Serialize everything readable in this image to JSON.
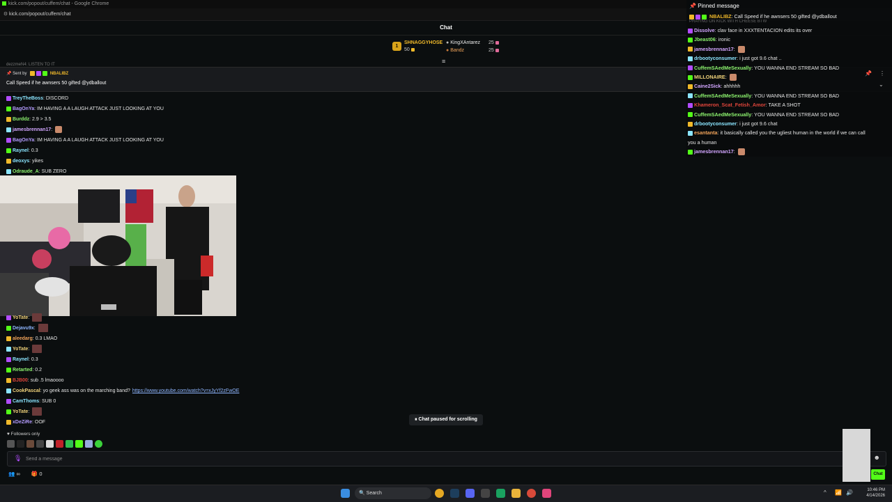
{
  "browser": {
    "title": "kick.com/popout/cuffem/chat - Google Chrome",
    "url": "kick.com/popout/cuffem/chat"
  },
  "chat": {
    "header": "Chat",
    "leaderboard": [
      {
        "rank": "1",
        "name": "SHNAGGYHOSE",
        "amount": "50"
      },
      {
        "name": "KingXAntarez",
        "amount": "25"
      },
      {
        "name": "Bandz",
        "amount": "25"
      }
    ],
    "cut_top": "dezzmeN4: LISTEN TO IT",
    "pinned": {
      "sent_by_label": "Sent by",
      "sender": "NBALIBZ",
      "text": "Call Speed if he awnsers 50 gifted @ydballout"
    },
    "messages_top": [
      {
        "user": "TreyTheBoss",
        "text": "DISCORD",
        "color": "#8be5ff"
      },
      {
        "user": "BagOnYa",
        "text": "IM HAVING A A LAUGH ATTACK JUST LOOKING AT YOU",
        "color": "#b49cff"
      },
      {
        "user": "Burddz",
        "text": "2.9 > 3.5",
        "color": "#8cf26e"
      },
      {
        "user": "jamesbrennan17",
        "text": "",
        "color": "#d2a6ff"
      },
      {
        "user": "BagOnYa",
        "text": "IM HAVING A A LAUGH ATTACK JUST LOOKING AT YOU",
        "color": "#b49cff"
      },
      {
        "user": "Raynel",
        "text": "0.3",
        "color": "#8be5ff"
      },
      {
        "user": "deoxys",
        "text": "yikes",
        "color": "#8be5ff"
      },
      {
        "user": "Odraude_A",
        "text": "SUB ZERO",
        "color": "#8cf26e"
      }
    ],
    "messages_bottom": [
      {
        "user": "YoTate",
        "text": "",
        "color": "#f0d27a"
      },
      {
        "user": "Dejavu9x",
        "text": "",
        "color": "#8fb6ff"
      },
      {
        "user": "aleedarg",
        "text": "0.3 LMAO",
        "color": "#f0a35a"
      },
      {
        "user": "YoTate",
        "text": "",
        "color": "#f0d27a"
      },
      {
        "user": "Raynel",
        "text": "0.3",
        "color": "#8be5ff"
      },
      {
        "user": "Retarted",
        "text": "0.2",
        "color": "#8cf26e"
      },
      {
        "user": "BJB00",
        "text": "sub .5 lmaoooo",
        "color": "#e0453b"
      },
      {
        "user": "CookPascal",
        "text": "yo geek ass was on the marching band?",
        "link": "https://www.youtube.com/watch?v=xJyYf2zFwOE",
        "color": "#f0d27a"
      },
      {
        "user": "CamThoms",
        "text": "SUB 0",
        "color": "#8be5ff"
      },
      {
        "user": "YoTate",
        "text": "",
        "color": "#f0d27a"
      },
      {
        "user": "xDeZiRe",
        "text": "OOF",
        "color": "#b49cff"
      }
    ],
    "paused_label": "Chat paused for scrolling",
    "followers_only": "Followers only",
    "input_placeholder": "Send a message",
    "stats": {
      "viewers": "∞",
      "count": "0"
    },
    "chat_button": "Chat"
  },
  "overlay": {
    "pinned_label": "Pinned message",
    "pinned_user": "NBALIBZ",
    "pinned_text": "Call Speed if he awnsers 50 gifted @ydballout",
    "cut_row": "PRAYING ON KICK WITH CHEESE BTW",
    "messages": [
      {
        "user": "Dissolve",
        "text": "clav face in XXXTENTACION edits its over",
        "color": "#d2a6ff"
      },
      {
        "user": "Jbeast06",
        "text": "ironic",
        "color": "#8cf26e"
      },
      {
        "user": "jamesbrennan17",
        "text": "",
        "color": "#d2a6ff"
      },
      {
        "user": "drbootyconsumer",
        "text": "i just got 9.6 chat ..",
        "color": "#8be5ff"
      },
      {
        "user": "CuffemSAedMeSexually",
        "text": "YOU WANNA END STREAM SO BAD",
        "color": "#8cf26e"
      },
      {
        "user": "MILLONAIRE",
        "text": "",
        "color": "#f0d27a"
      },
      {
        "user": "Caine2Sick",
        "text": "ahhhhh",
        "color": "#d2a6ff"
      },
      {
        "user": "CuffemSAedMeSexually",
        "text": "YOU WANNA END STREAM SO BAD",
        "color": "#8cf26e"
      },
      {
        "user": "Khameron_Scat_Fetish_Amor",
        "text": "TAKE A SHOT",
        "color": "#e0453b"
      },
      {
        "user": "CuffemSAedMeSexually",
        "text": "YOU WANNA END STREAM SO BAD",
        "color": "#8cf26e"
      },
      {
        "user": "drbootyconsumer",
        "text": "i just got 9.6 chat",
        "color": "#8be5ff"
      },
      {
        "user": "esantanta",
        "text": "it basically called you the ugliest human in the world if we can call",
        "color": "#f0a35a"
      },
      {
        "user": "",
        "text": "you a human",
        "color": "#e6e6e6"
      },
      {
        "user": "jamesbrennan17",
        "text": "",
        "color": "#d2a6ff"
      }
    ]
  },
  "taskbar": {
    "search": "Search",
    "time": "10:46 PM",
    "date": "4/14/2026"
  }
}
